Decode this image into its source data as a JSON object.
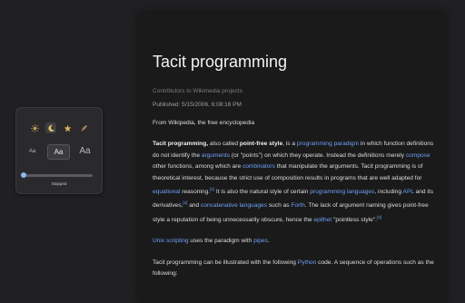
{
  "reader": {
    "themes": [
      "sun-icon",
      "moon-icon",
      "star-icon",
      "feather-icon"
    ],
    "active_theme": "moon",
    "font_sizes": [
      "Aa",
      "Aa",
      "Aa"
    ],
    "active_font_size": "medium",
    "tts_status": "Stopped",
    "tts_progress": 0.0,
    "accent_color": "#8fb6f0"
  },
  "article": {
    "title": "Tacit programming",
    "credits": "Contributors to Wikimedia projects",
    "published": "Published: 5/15/2006, 6:08:16 PM",
    "source": "From Wikipedia, the free encyclopedia",
    "p1": {
      "t1": "Tacit programming,",
      "t2": " also called ",
      "t3": "point-free style",
      "t4": ", is a ",
      "l1": "programming paradigm",
      "t5": " in which function definitions do not identify the ",
      "l2": "arguments",
      "t6": " (or \"points\") on which they operate. Instead the definitions merely ",
      "l3": "compose",
      "t7": " other functions, among which are ",
      "l4": "combinators",
      "t8": " that manipulate the arguments. Tacit programming is of theoretical interest, because the strict use of composition results in programs that are well adapted for ",
      "l5": "equational",
      "t9": " reasoning.",
      "r1": "[1]",
      "t10": " It is also the natural style of certain ",
      "l6": "programming languages",
      "t11": ", including ",
      "l7": "APL",
      "t12": " and its derivatives,",
      "r2": "[2]",
      "t13": " and ",
      "l8": "concatenative languages",
      "t14": " such as ",
      "l9": "Forth",
      "t15": ". The lack of argument naming gives point-free style a reputation of being unnecessarily obscure, hence the ",
      "l10": "epithet",
      "t16": " \"pointless style\".",
      "r3": "[3]"
    },
    "p2": {
      "l1": "Unix scripting",
      "t1": " uses the paradigm with ",
      "l2": "pipes",
      "t2": "."
    },
    "p3": {
      "t1": "Tacit programming can be illustrated with the following ",
      "l1": "Python",
      "t2": " code. A sequence of operations such as the following:"
    },
    "link_color": "#6ea0f5"
  }
}
